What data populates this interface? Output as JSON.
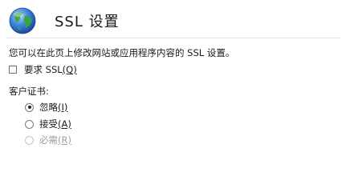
{
  "header": {
    "title": "SSL 设置"
  },
  "description": "您可以在此页上修改网站或应用程序内容的 SSL 设置。",
  "require_ssl": {
    "label": "要求 SSL",
    "hotkey": "(Q)",
    "checked": false
  },
  "client_certificates": {
    "label": "客户证书:",
    "options": [
      {
        "label": "忽略",
        "hotkey": "(I)",
        "selected": true,
        "enabled": true
      },
      {
        "label": "接受",
        "hotkey": "(A)",
        "selected": false,
        "enabled": true
      },
      {
        "label": "必需",
        "hotkey": "(R)",
        "selected": false,
        "enabled": false
      }
    ]
  },
  "icons": {
    "header_icon": "globe-icon"
  },
  "colors": {
    "globe_water": "#2a6fd0",
    "globe_land": "#3da53a",
    "disabled_text": "#a0a0a0"
  }
}
